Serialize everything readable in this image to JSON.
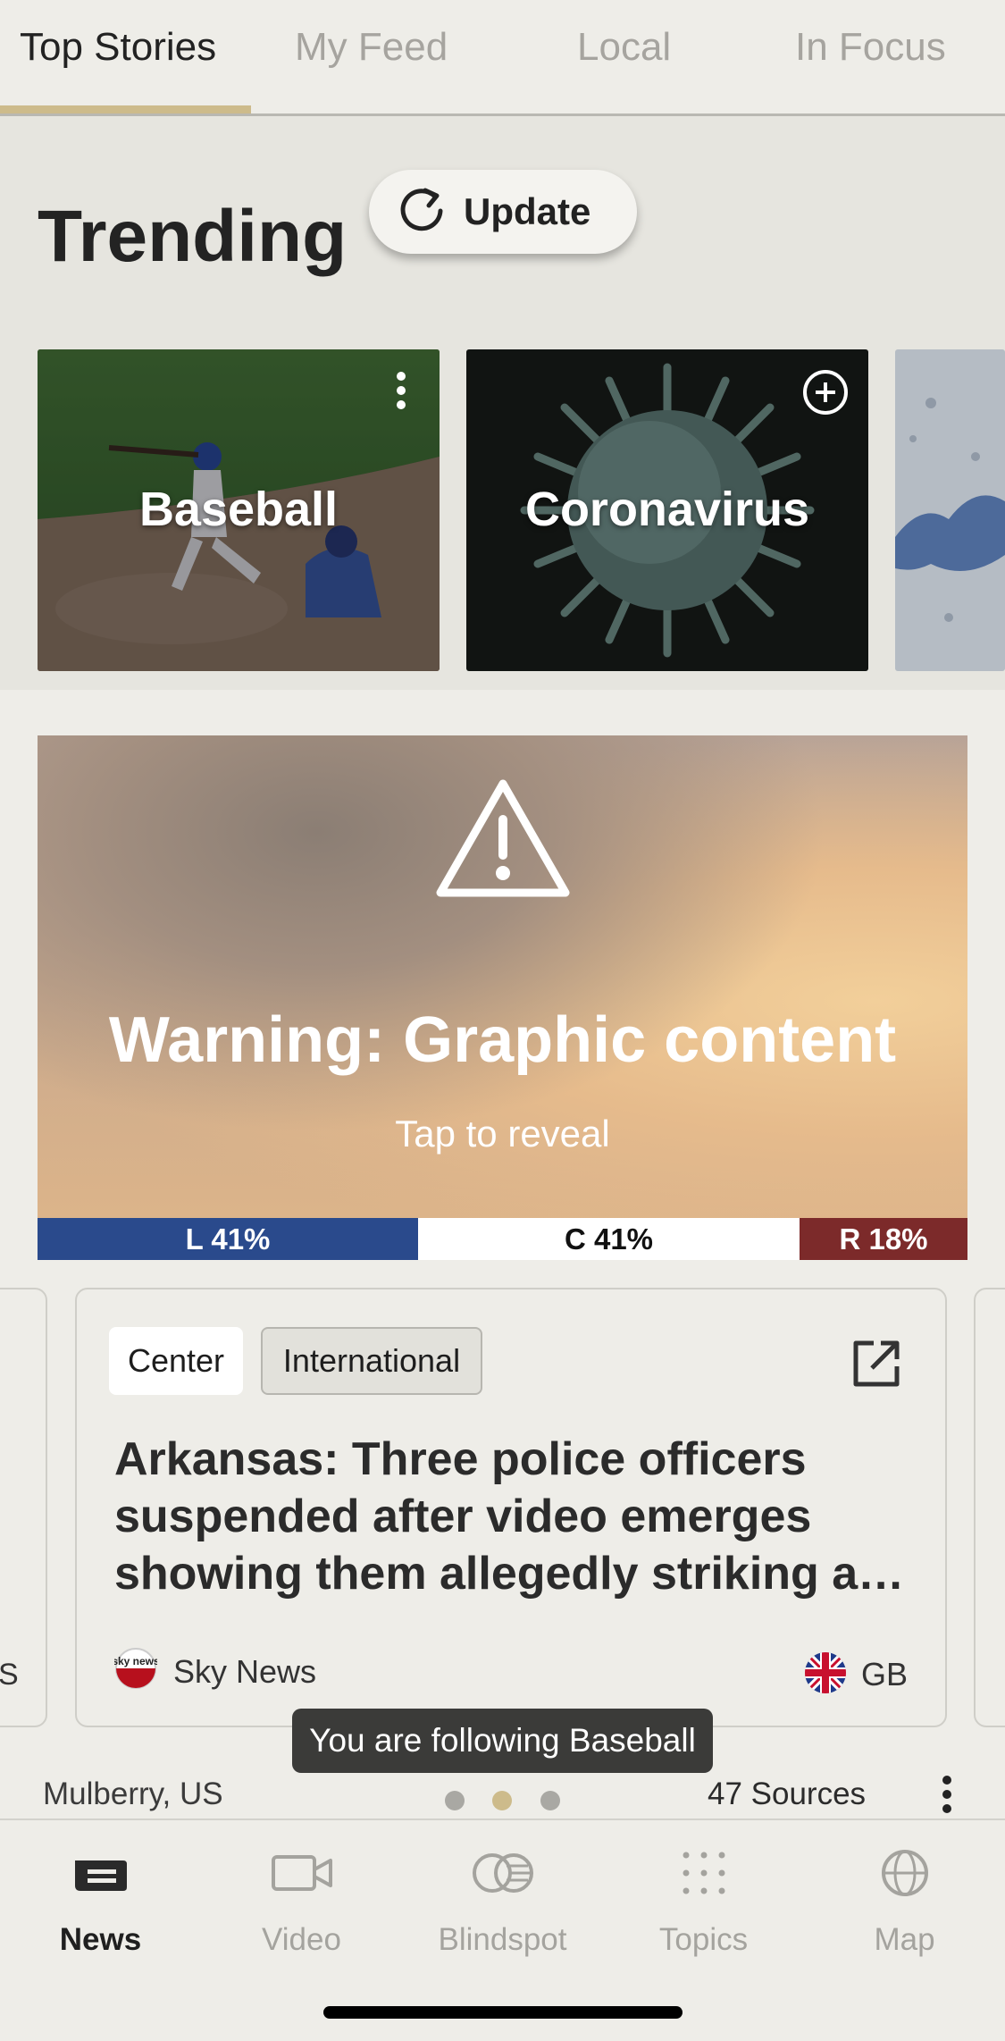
{
  "tabs": [
    {
      "label": "Top Stories",
      "active": true
    },
    {
      "label": "My Feed",
      "active": false
    },
    {
      "label": "Local",
      "active": false
    },
    {
      "label": "In Focus",
      "active": false
    }
  ],
  "trending": {
    "title": "Trending",
    "update_label": "Update",
    "cards": [
      {
        "label": "Baseball",
        "icon": "more-vertical-icon"
      },
      {
        "label": "Coronavirus",
        "icon": "add-circle-icon"
      },
      {
        "label": "",
        "icon": ""
      }
    ]
  },
  "warning": {
    "title": "Warning: Graphic content",
    "subtitle": "Tap to reveal"
  },
  "bias": {
    "left": "L 41%",
    "center": "C 41%",
    "right": "R 18%",
    "left_fraction": 0.41,
    "center_fraction": 0.41,
    "right_fraction": 0.18
  },
  "story": {
    "tags": [
      "Center",
      "International"
    ],
    "headline": "Arkansas: Three police officers suspended after video emerges showing them allegedly striking a…",
    "source": "Sky News",
    "source_logo_text": "sky news",
    "country": "GB"
  },
  "side_card_fragment": "S",
  "toast": "You are following Baseball",
  "footer": {
    "location": "Mulberry, US",
    "sources": "47 Sources",
    "active_page_index": 1,
    "page_count": 3
  },
  "nav": [
    {
      "label": "News",
      "icon": "news-icon",
      "active": true
    },
    {
      "label": "Video",
      "icon": "video-icon",
      "active": false
    },
    {
      "label": "Blindspot",
      "icon": "blindspot-icon",
      "active": false
    },
    {
      "label": "Topics",
      "icon": "topics-icon",
      "active": false
    },
    {
      "label": "Map",
      "icon": "globe-icon",
      "active": false
    }
  ],
  "colors": {
    "accent": "#cdbb8b",
    "bias_left": "#2a4a8c",
    "bias_center": "#ffffff",
    "bias_right": "#7c2a2a"
  }
}
